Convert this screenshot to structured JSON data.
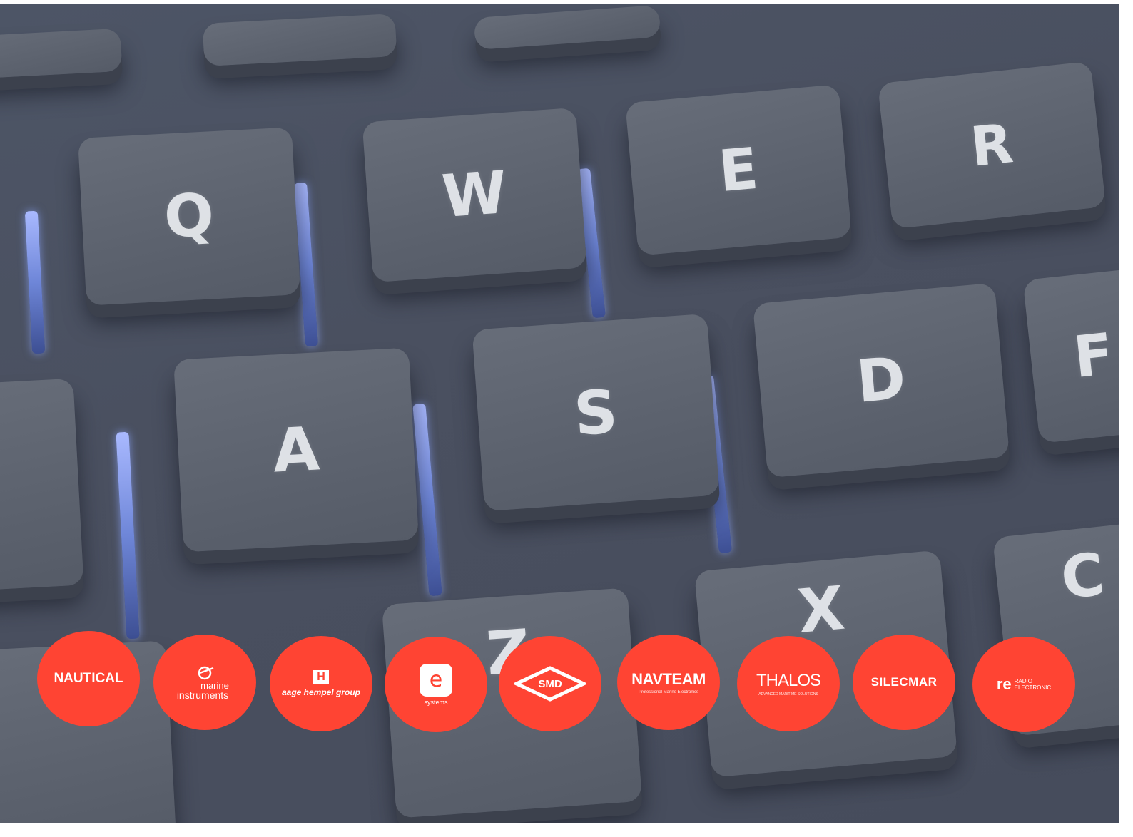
{
  "keys": [
    {
      "letter": "Q"
    },
    {
      "letter": "W"
    },
    {
      "letter": "E"
    },
    {
      "letter": "R"
    },
    {
      "letter": "A"
    },
    {
      "letter": "S"
    },
    {
      "letter": "D"
    },
    {
      "letter": "F"
    },
    {
      "letter": "Z"
    },
    {
      "letter": "X"
    },
    {
      "letter": "C"
    }
  ],
  "logos": [
    {
      "name": "NAUTICAL"
    },
    {
      "name": "marine",
      "name2": "instruments"
    },
    {
      "name": "aage hempel group",
      "mark": "H"
    },
    {
      "name": "systems",
      "mark": "e"
    },
    {
      "name": "SMD"
    },
    {
      "name": "NAVTEAM",
      "sub": "Professional Marine Electronics"
    },
    {
      "name": "THALOS",
      "sub": "ADVANCED MARITIME SOLUTIONS"
    },
    {
      "name": "SILECMAR"
    },
    {
      "name": "RADIO",
      "name2": "ELECTRONIC",
      "mark": "re"
    }
  ],
  "colors": {
    "logo_bg": "#ff4433",
    "keyboard_bg": "#4a5060",
    "key_glow": "#8fa3ff"
  }
}
